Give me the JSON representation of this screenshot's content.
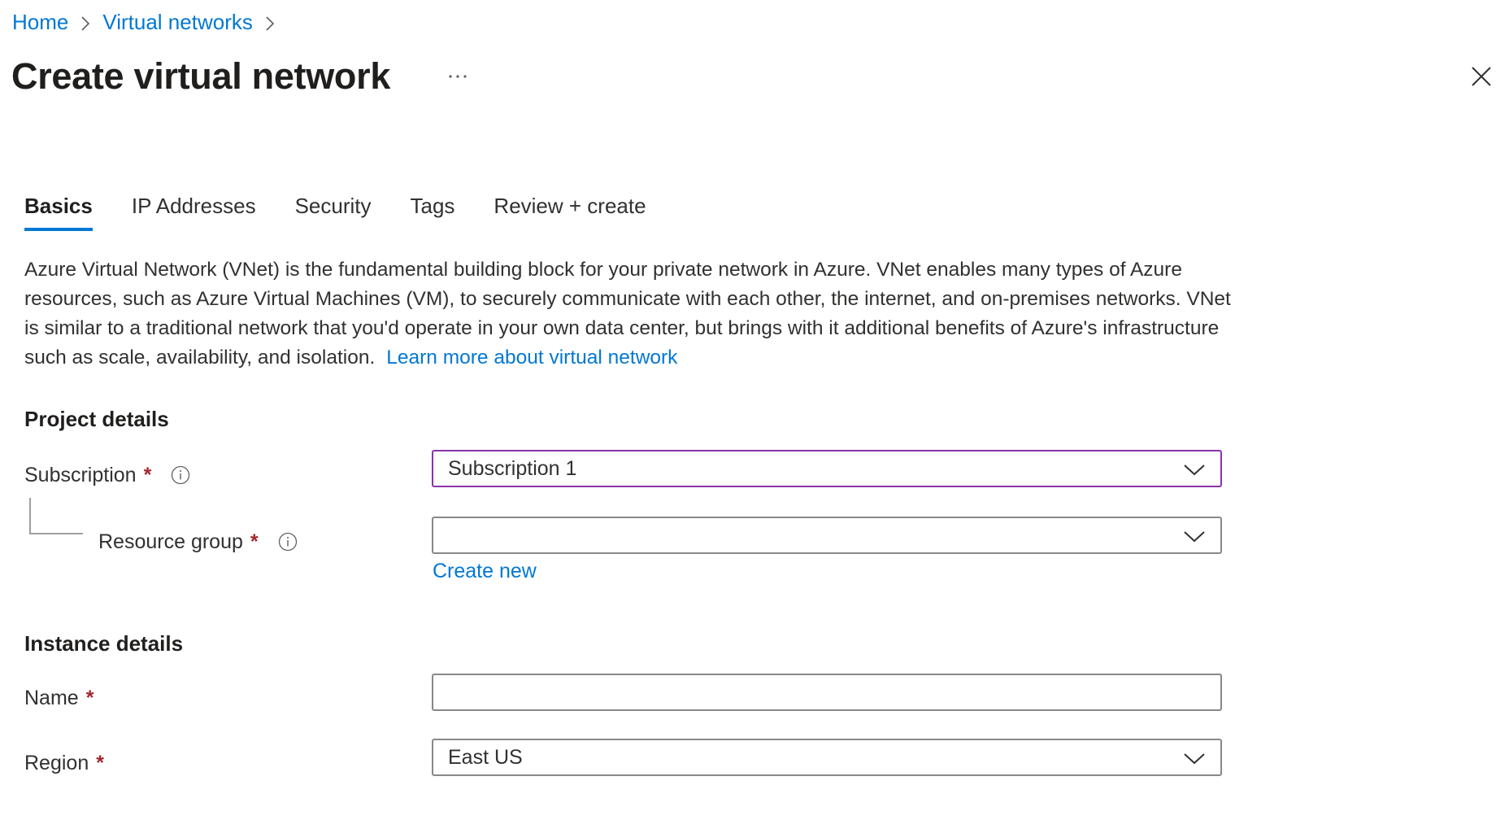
{
  "breadcrumb": {
    "items": [
      {
        "label": "Home"
      },
      {
        "label": "Virtual networks"
      }
    ]
  },
  "header": {
    "title": "Create virtual network",
    "more_icon": "ellipsis-icon",
    "close_icon": "close-icon"
  },
  "tabs": [
    {
      "label": "Basics",
      "active": true
    },
    {
      "label": "IP Addresses",
      "active": false
    },
    {
      "label": "Security",
      "active": false
    },
    {
      "label": "Tags",
      "active": false
    },
    {
      "label": "Review + create",
      "active": false
    }
  ],
  "description": {
    "text": "Azure Virtual Network (VNet) is the fundamental building block for your private network in Azure. VNet enables many types of Azure resources, such as Azure Virtual Machines (VM), to securely communicate with each other, the internet, and on-premises networks. VNet is similar to a traditional network that you'd operate in your own data center, but brings with it additional benefits of Azure's infrastructure such as scale, availability, and isolation.",
    "link": "Learn more about virtual network"
  },
  "project_details": {
    "heading": "Project details",
    "subscription": {
      "label": "Subscription",
      "required": "*",
      "value": "Subscription 1",
      "icon": "info-icon"
    },
    "resource_group": {
      "label": "Resource group",
      "required": "*",
      "value": "",
      "icon": "info-icon",
      "create_new": "Create new"
    }
  },
  "instance_details": {
    "heading": "Instance details",
    "name": {
      "label": "Name",
      "required": "*",
      "value": ""
    },
    "region": {
      "label": "Region",
      "required": "*",
      "value": "East US"
    }
  },
  "colors": {
    "accent": "#0078d4",
    "focus_border": "#8a34a8",
    "required": "#a4262c",
    "border": "#8a8886",
    "text": "#323130"
  }
}
